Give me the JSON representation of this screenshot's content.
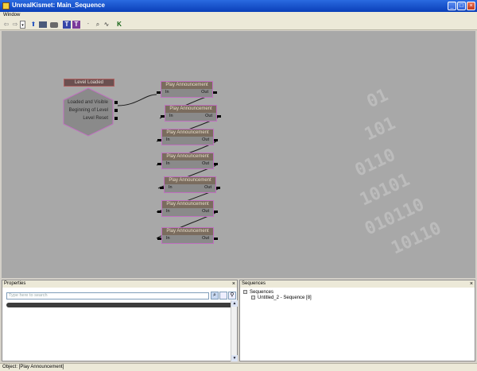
{
  "window": {
    "title": "UnrealKismet: Main_Sequence"
  },
  "menu": {
    "items": [
      "Window"
    ]
  },
  "toolbar": {
    "icons": [
      "back-arrow-icon",
      "forward-arrow-icon",
      "dropdown-icon",
      "up-arrow-icon",
      "sequence-icon",
      "screenshot-icon",
      "search-text-icon",
      "search-type-icon",
      "tag-icon",
      "zoom-icon",
      "link-icon",
      "kismet-icon"
    ]
  },
  "canvas": {
    "event_node": {
      "title": "Level Loaded",
      "outputs": [
        "Loaded and Visible",
        "Beginning of Level",
        "Level Reset"
      ]
    },
    "actions": [
      {
        "title": "Play Announcement",
        "in": "In",
        "out": "Out"
      },
      {
        "title": "Play Announcement",
        "in": "In",
        "out": "Out"
      },
      {
        "title": "Play Announcement",
        "in": "In",
        "out": "Out"
      },
      {
        "title": "Play Announcement",
        "in": "In",
        "out": "Out"
      },
      {
        "title": "Play Announcement",
        "in": "In",
        "out": "Out"
      },
      {
        "title": "Play Announcement",
        "in": "In",
        "out": "Out"
      },
      {
        "title": "Play Announcement",
        "in": "In",
        "out": "Out"
      }
    ]
  },
  "properties": {
    "title": "Properties",
    "search_placeholder": "Type here to search"
  },
  "sequences": {
    "title": "Sequences",
    "root": "Sequences",
    "child": "Untitled_2 - Sequence [8]"
  },
  "status": {
    "text": "Object: [Play Announcement]"
  },
  "colors": {
    "titlebar": "#0a3fb8",
    "canvas": "#a8a8a8",
    "node_border": "#c070c0"
  }
}
